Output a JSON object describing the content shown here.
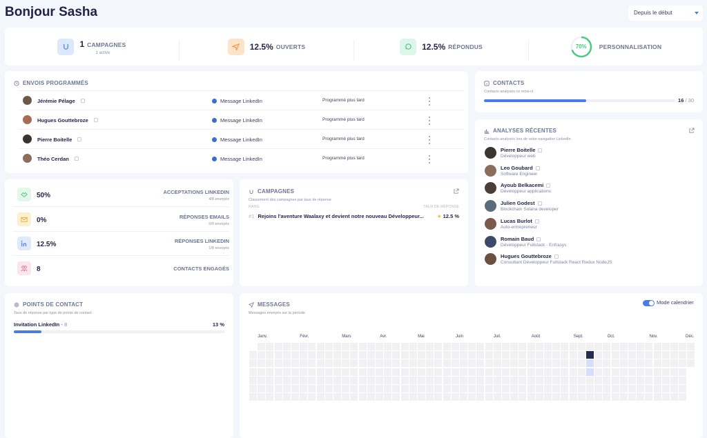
{
  "header": {
    "greeting": "Bonjour Sasha",
    "period_select": "Depuis le début"
  },
  "kpis": [
    {
      "icon": "branch-icon",
      "value": "1",
      "label": "CAMPAGNES",
      "sub": "1 active"
    },
    {
      "icon": "send-icon",
      "value": "12.5%",
      "label": "OUVERTS"
    },
    {
      "icon": "chat-icon",
      "value": "12.5%",
      "label": "RÉPONDUS"
    },
    {
      "icon": "progress-ring",
      "value": "70%",
      "label": "PERSONNALISATION",
      "percent": 70
    }
  ],
  "envois": {
    "title": "ENVOIS PROGRAMMÉS",
    "rows": [
      {
        "name": "Jérémie Pélage",
        "channel": "Message LinkedIn",
        "status": "Programmé plus tard"
      },
      {
        "name": "Hugues Gouttebroze",
        "channel": "Message LinkedIn",
        "status": "Programmé plus tard"
      },
      {
        "name": "Pierre Boitelle",
        "channel": "Message LinkedIn",
        "status": "Programmé plus tard"
      },
      {
        "name": "Théo Cerdan",
        "channel": "Message LinkedIn",
        "status": "Programmé plus tard"
      }
    ]
  },
  "contacts": {
    "title": "CONTACTS",
    "subtitle": "Contacts analysés ce mois-ci",
    "used": "16",
    "total": "/ 30",
    "fraction": 0.5333
  },
  "analyses": {
    "title": "ANALYSES RÉCENTES",
    "subtitle": "Contacts analysés lors de votre navigation LinkedIn",
    "people": [
      {
        "name": "Pierre Boitelle",
        "job": "Développeur web"
      },
      {
        "name": "Leo Goubard",
        "job": "Software Engineer"
      },
      {
        "name": "Ayoub Belkacemi",
        "job": "Développeur applications"
      },
      {
        "name": "Julien Godest",
        "job": "Blockchain Solana developer"
      },
      {
        "name": "Lucas Burlot",
        "job": "Auto-entrepreneur"
      },
      {
        "name": "Romain Baud",
        "job": "Développeur Fullstack - Enfrasys"
      },
      {
        "name": "Hugues Gouttebroze",
        "job": "Consultant Développeur Fullstack React Redux NodeJS"
      }
    ]
  },
  "stats": [
    {
      "icon": "handshake-icon",
      "value": "50%",
      "label": "ACCEPTATIONS LINKEDIN",
      "sub": "4/8 envoyés",
      "color": "#e3f6ea"
    },
    {
      "icon": "mail-icon",
      "value": "0%",
      "label": "RÉPONSES EMAILS",
      "sub": "0/0 envoyés",
      "color": "#fdf0cf"
    },
    {
      "icon": "linkedin-icon",
      "value": "12.5%",
      "label": "RÉPONSES LINKEDIN",
      "sub": "1/8 envoyés",
      "color": "#dfe9fb"
    },
    {
      "icon": "users-icon",
      "value": "8",
      "label": "CONTACTS ENGAGÉS",
      "sub": "",
      "color": "#fbe6ec"
    }
  ],
  "campagnes": {
    "title": "CAMPAGNES",
    "subtitle": "Classement des campagnes par taux de réponse",
    "col_rank": "RANG",
    "col_rate": "TAUX DE RÉPONSE",
    "rows": [
      {
        "rank": "#1",
        "name": "Rejoins l'aventure Waalaxy et devient notre nouveau Développeur...",
        "rate": "12.5 %"
      }
    ]
  },
  "points": {
    "title": "POINTS DE CONTACT",
    "subtitle": "Taux de réponse par type de points de contact",
    "rows": [
      {
        "label": "Invitation LinkedIn",
        "count": "8",
        "percent_label": "13 %",
        "fraction": 0.13
      }
    ]
  },
  "messages": {
    "title": "MESSAGES",
    "subtitle": "Messages envoyés sur la période",
    "toggle_label": "Mode calendrier",
    "toggle_on": true,
    "months": [
      "Janv.",
      "Févr.",
      "Mars",
      "Avr.",
      "Mai",
      "Juin",
      "Juil.",
      "Août",
      "Sept.",
      "Oct.",
      "Nov.",
      "Déc."
    ],
    "active_cells": [
      {
        "week": 40,
        "day": 1,
        "level": "high"
      },
      {
        "week": 40,
        "day": 2,
        "level": "low"
      },
      {
        "week": 40,
        "day": 3,
        "level": "low"
      }
    ]
  }
}
